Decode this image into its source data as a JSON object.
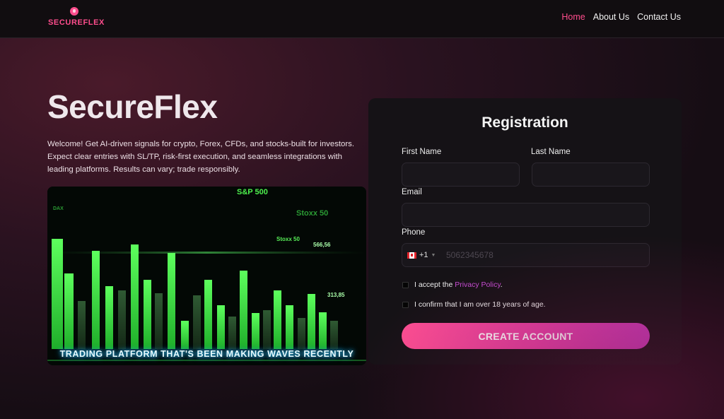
{
  "header": {
    "brand": "SECUREFLEX",
    "nav": [
      {
        "label": "Home",
        "active": true
      },
      {
        "label": "About Us",
        "active": false
      },
      {
        "label": "Contact Us",
        "active": false
      }
    ]
  },
  "hero": {
    "title": "SecureFlex",
    "description": "Welcome! Get AI-driven signals for crypto, Forex, CFDs, and stocks-built for investors. Expect clear entries with SL/TP, risk-first execution, and seamless integrations with leading platforms. Results can vary; trade responsibly.",
    "image": {
      "caption": "TRADING PLATFORM THAT'S BEEN MAKING WAVES RECENTLY",
      "labels": [
        "S&P 500",
        "Stoxx 50",
        "Stoxx 50",
        "DAX",
        "566,56",
        "313,85"
      ]
    }
  },
  "registration": {
    "title": "Registration",
    "first_name_label": "First Name",
    "last_name_label": "Last Name",
    "email_label": "Email",
    "phone_label": "Phone",
    "phone_prefix": "+1",
    "phone_placeholder": "5062345678",
    "privacy_text_before": "I accept the",
    "privacy_link": "Privacy Policy",
    "privacy_text_after": ".",
    "age_text": "I confirm that I am over 18 years of age.",
    "submit_label": "CREATE ACCOUNT"
  },
  "colors": {
    "accent": "#ff4d8d",
    "link": "#c94ed6",
    "chart_green": "#3ff03f"
  }
}
